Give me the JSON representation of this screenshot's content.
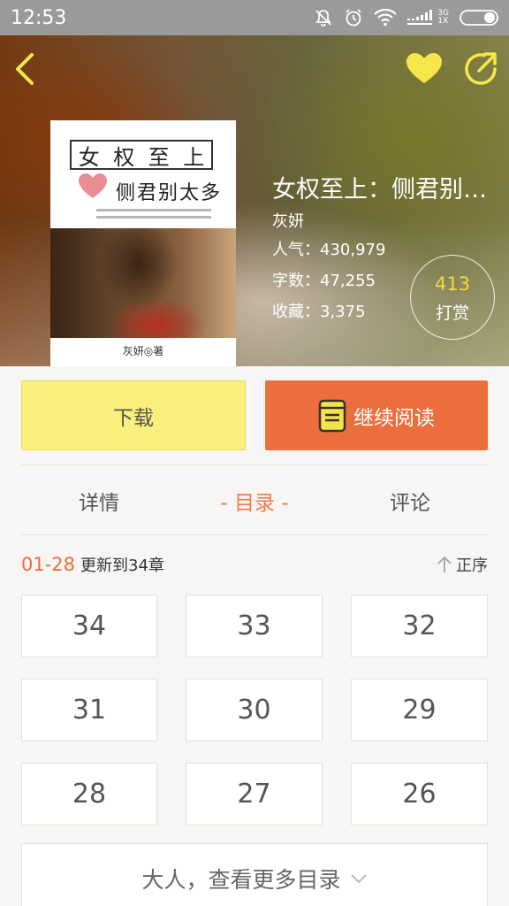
{
  "status_bar": {
    "time": "12:53",
    "network_top": "3G",
    "network_bottom": "1X",
    "icons": [
      "mute-icon",
      "alarm-icon",
      "wifi-icon",
      "signal-icon",
      "battery-icon"
    ]
  },
  "header": {
    "icons": [
      "back-icon",
      "heart-icon",
      "share-icon"
    ],
    "favorite_color": "#f5d83a"
  },
  "book": {
    "cover_title_chars": [
      "女",
      "权",
      "至",
      "上"
    ],
    "cover_subtitle": "侧君别太多",
    "cover_author": "灰妍◎著",
    "title": "女权至上：侧君别…",
    "author": "灰妍",
    "popularity": "人气：430,979",
    "words": "字数：47,255",
    "favorites": "收藏：3,375",
    "tip_count": "413",
    "tip_label": "打赏"
  },
  "actions": {
    "download": "下载",
    "continue_reading": "继续阅读",
    "download_color": "#f9ef7c",
    "read_color": "#ec6d3d"
  },
  "tabs": [
    {
      "label": "详情",
      "active": false
    },
    {
      "label": "- 目录 -",
      "active": true
    },
    {
      "label": "评论",
      "active": false
    }
  ],
  "catalog": {
    "date_range": "01-28",
    "update_text": "更新到34章",
    "sort_label": "正序",
    "chapters": [
      "34",
      "33",
      "32",
      "31",
      "30",
      "29",
      "28",
      "27",
      "26"
    ],
    "more_label": "大人，查看更多目录",
    "accent_color": "#ea6f3d"
  }
}
